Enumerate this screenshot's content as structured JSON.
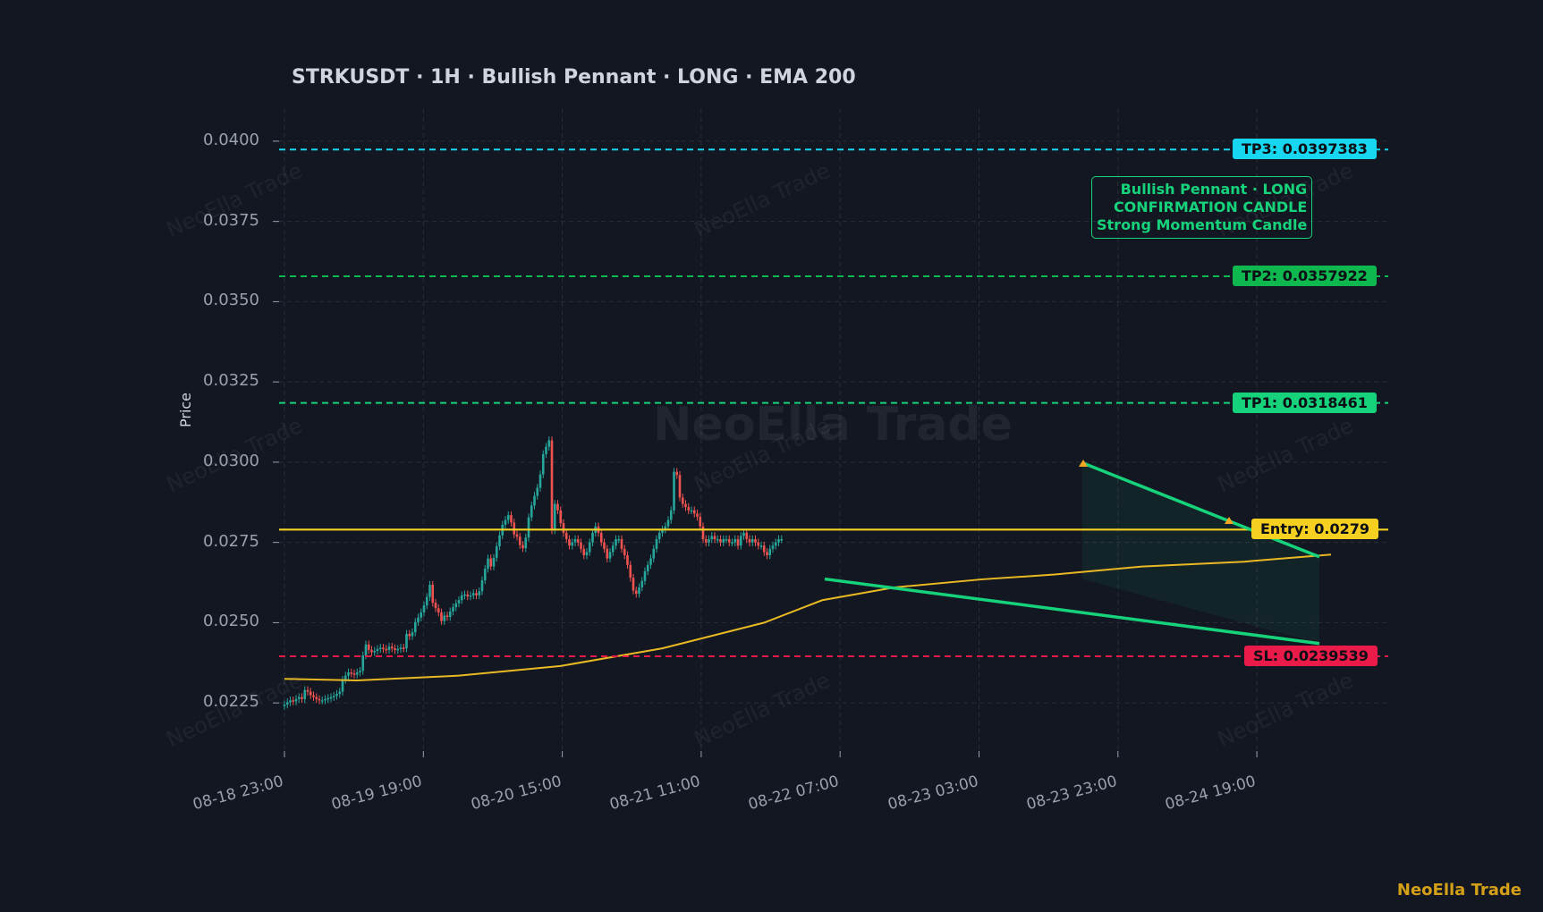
{
  "title": "STRKUSDT  ·  1H  ·  Bullish Pennant  ·  LONG  ·  EMA 200",
  "brand": "NeoElla Trade",
  "watermark": "NeoElla Trade",
  "colors": {
    "background": "#131722",
    "grid": "#2a2e39",
    "up": "#26a69a",
    "down": "#ef5350",
    "ema": "#e8b923",
    "entry": "#f5d020",
    "tp1": "#16d27a",
    "tp2": "#0fb84f",
    "tp3": "#16d6f0",
    "sl": "#ea1b48",
    "pennant": "#16d27a"
  },
  "chart_data": {
    "type": "candlestick",
    "ylabel": "Price",
    "ylim": [
      0.021,
      0.041
    ],
    "y_ticks": [
      "0.0225",
      "0.0250",
      "0.0275",
      "0.0300",
      "0.0325",
      "0.0350",
      "0.0375",
      "0.0400"
    ],
    "x_ticks": [
      "08-18 23:00",
      "08-19 19:00",
      "08-20 15:00",
      "08-21 11:00",
      "08-22 07:00",
      "08-23 03:00",
      "08-23 23:00",
      "08-24 19:00"
    ],
    "candles_close": [
      0.02245,
      0.02252,
      0.02258,
      0.02255,
      0.02262,
      0.02268,
      0.02262,
      0.0229,
      0.02285,
      0.02274,
      0.02268,
      0.02262,
      0.02258,
      0.02258,
      0.02262,
      0.02265,
      0.02268,
      0.02272,
      0.02278,
      0.02285,
      0.02322,
      0.02335,
      0.02345,
      0.02342,
      0.02338,
      0.02345,
      0.0235,
      0.02398,
      0.02432,
      0.02415,
      0.02408,
      0.02412,
      0.02418,
      0.02422,
      0.02418,
      0.02415,
      0.02425,
      0.0242,
      0.02415,
      0.02418,
      0.02422,
      0.0242,
      0.02465,
      0.02458,
      0.0247,
      0.02502,
      0.02516,
      0.02532,
      0.02554,
      0.0258,
      0.02618,
      0.02562,
      0.02545,
      0.02532,
      0.02505,
      0.02522,
      0.02518,
      0.02535,
      0.02548,
      0.0256,
      0.0257,
      0.02585,
      0.02588,
      0.02582,
      0.02585,
      0.02592,
      0.02585,
      0.02598,
      0.02632,
      0.02668,
      0.027,
      0.02675,
      0.02702,
      0.02738,
      0.02772,
      0.02805,
      0.0282,
      0.02835,
      0.02812,
      0.02775,
      0.02768,
      0.02742,
      0.02732,
      0.02765,
      0.02828,
      0.02865,
      0.02895,
      0.0292,
      0.02962,
      0.03025,
      0.03048,
      0.03068,
      0.02788,
      0.0287,
      0.0285,
      0.0281,
      0.0278,
      0.0276,
      0.0274,
      0.0275,
      0.0276,
      0.0275,
      0.0273,
      0.0271,
      0.0272,
      0.0275,
      0.0278,
      0.028,
      0.0278,
      0.0275,
      0.0273,
      0.027,
      0.0272,
      0.0274,
      0.0276,
      0.0276,
      0.0273,
      0.0271,
      0.0268,
      0.0264,
      0.026,
      0.0259,
      0.0261,
      0.0263,
      0.0266,
      0.0268,
      0.027,
      0.0273,
      0.0276,
      0.0278,
      0.0279,
      0.028,
      0.0282,
      0.0285,
      0.0297,
      0.0296,
      0.0289,
      0.0287,
      0.0286,
      0.0285,
      0.0285,
      0.0284,
      0.0283,
      0.028,
      0.0276,
      0.0275,
      0.0276,
      0.0277,
      0.0276,
      0.0276,
      0.0275,
      0.0276,
      0.0276,
      0.0275,
      0.0275,
      0.0276,
      0.0274,
      0.0277,
      0.0278,
      0.0276,
      0.0275,
      0.0276,
      0.0275,
      0.0274,
      0.0274,
      0.0272,
      0.0271,
      0.0273,
      0.0274,
      0.0275,
      0.0276,
      0.0276
    ],
    "ema_200": [
      [
        0,
        0.02325
      ],
      [
        25,
        0.0232
      ],
      [
        60,
        0.02335
      ],
      [
        95,
        0.02365
      ],
      [
        130,
        0.0242
      ],
      [
        165,
        0.025
      ],
      [
        185,
        0.0257
      ],
      [
        210,
        0.0261
      ],
      [
        240,
        0.02635
      ],
      [
        265,
        0.0265
      ],
      [
        295,
        0.02675
      ],
      [
        330,
        0.0269
      ],
      [
        360,
        0.02712
      ]
    ],
    "levels": [
      {
        "label": "TP3: 0.0397383",
        "value": 0.0397383
      },
      {
        "label": "TP2: 0.0357922",
        "value": 0.0357922
      },
      {
        "label": "TP1: 0.0318461",
        "value": 0.0318461
      },
      {
        "label": "Entry: 0.0279",
        "value": 0.0279
      },
      {
        "label": "SL: 0.0239539",
        "value": 0.0239539
      }
    ],
    "pennant": {
      "upper": [
        [
          0.02998,
          0.02705
        ]
      ],
      "lower": [
        [
          0.02636,
          0.02435
        ]
      ]
    },
    "annotation": [
      "Bullish Pennant · LONG",
      "CONFIRMATION CANDLE",
      "Strong Momentum Candle"
    ],
    "grid": true
  }
}
